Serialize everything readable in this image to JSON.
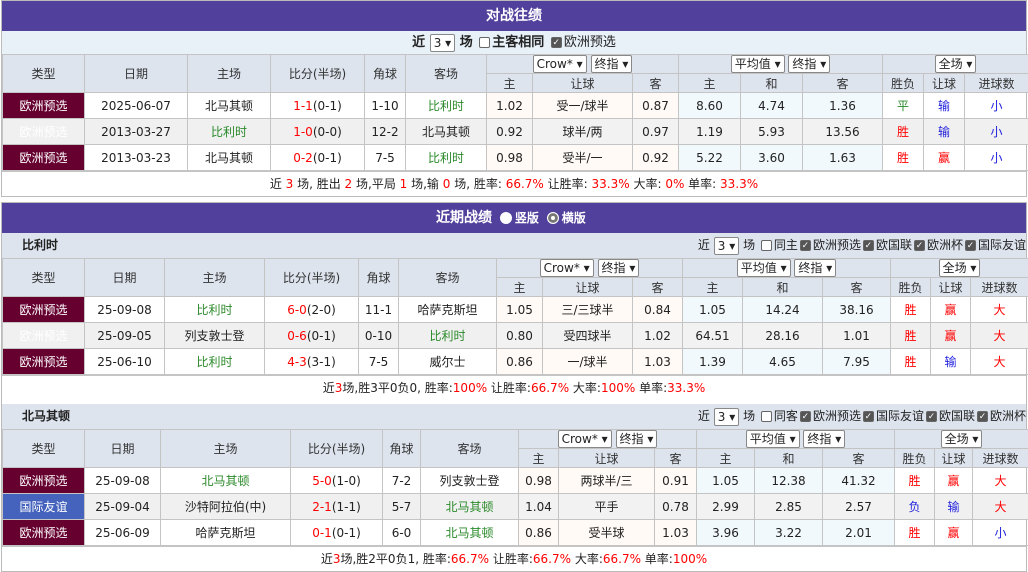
{
  "h2h": {
    "title": "对战往绩",
    "filter": {
      "near": "近",
      "count": "3",
      "unit": "场",
      "same_label": "主客相同",
      "same_checked": false,
      "euro_label": "欧洲预选",
      "euro_checked": true
    },
    "headers": {
      "type": "类型",
      "date": "日期",
      "home": "主场",
      "score": "比分(半场)",
      "corner": "角球",
      "away": "客场",
      "ah_sel1": "Crow*",
      "ah_sel2": "终指",
      "eu_sel1": "平均值",
      "eu_sel2": "终指",
      "res_sel": "全场",
      "ah_h": "主",
      "ah_line": "让球",
      "ah_a": "客",
      "eu_h": "主",
      "eu_d": "和",
      "eu_a": "客",
      "wl": "胜负",
      "hc": "让球",
      "ou": "进球数"
    },
    "rows": [
      {
        "type": "欧洲预选",
        "date": "2025-06-07",
        "home": "北马其顿",
        "home_hl": false,
        "score": "1-1",
        "half": "(0-1)",
        "corner": "1-10",
        "away": "比利时",
        "away_hl": true,
        "ah_h": "1.02",
        "ah_line": "受一/球半",
        "ah_a": "0.87",
        "eu_h": "8.60",
        "eu_d": "4.74",
        "eu_a": "1.36",
        "wl": "平",
        "hc": "输",
        "ou": "小"
      },
      {
        "type": "欧洲预选",
        "date": "2013-03-27",
        "home": "比利时",
        "home_hl": true,
        "score": "1-0",
        "half": "(0-0)",
        "corner": "12-2",
        "away": "北马其顿",
        "away_hl": false,
        "ah_h": "0.92",
        "ah_line": "球半/两",
        "ah_a": "0.97",
        "eu_h": "1.19",
        "eu_d": "5.93",
        "eu_a": "13.56",
        "wl": "胜",
        "hc": "输",
        "ou": "小"
      },
      {
        "type": "欧洲预选",
        "date": "2013-03-23",
        "home": "北马其顿",
        "home_hl": false,
        "score": "0-2",
        "half": "(0-1)",
        "corner": "7-5",
        "away": "比利时",
        "away_hl": true,
        "ah_h": "0.98",
        "ah_line": "受半/一",
        "ah_a": "0.92",
        "eu_h": "5.22",
        "eu_d": "3.60",
        "eu_a": "1.63",
        "wl": "胜",
        "hc": "赢",
        "ou": "小"
      }
    ],
    "summary": [
      [
        "近 ",
        0
      ],
      [
        "3",
        1
      ],
      [
        " 场, 胜出 ",
        0
      ],
      [
        "2",
        1
      ],
      [
        " 场,平局 ",
        0
      ],
      [
        "1",
        1
      ],
      [
        " 场,输 ",
        0
      ],
      [
        "0",
        1
      ],
      [
        " 场, 胜率: ",
        0
      ],
      [
        "66.7%",
        1
      ],
      [
        " 让胜率: ",
        0
      ],
      [
        "33.3%",
        1
      ],
      [
        " 大率: ",
        0
      ],
      [
        "0%",
        1
      ],
      [
        " 单率: ",
        0
      ],
      [
        "33.3%",
        1
      ]
    ]
  },
  "recent": {
    "title": "近期战绩",
    "opt1": "竖版",
    "opt2": "横版",
    "selected": "横版",
    "teams": [
      {
        "name": "比利时",
        "near": "近",
        "count": "3",
        "unit": "场",
        "same_label": "同主",
        "checks": [
          "欧洲预选",
          "欧国联",
          "欧洲杯",
          "国际友谊"
        ],
        "rows": [
          {
            "type": "欧洲预选",
            "date": "25-09-08",
            "home": "比利时",
            "home_hl": true,
            "score": "6-0",
            "half": "(2-0)",
            "corner": "11-1",
            "away": "哈萨克斯坦",
            "away_hl": false,
            "ah_h": "1.05",
            "ah_line": "三/三球半",
            "ah_a": "0.84",
            "eu_h": "1.05",
            "eu_d": "14.24",
            "eu_a": "38.16",
            "wl": "胜",
            "hc": "赢",
            "ou": "大"
          },
          {
            "type": "欧洲预选",
            "date": "25-09-05",
            "home": "列支敦士登",
            "home_hl": false,
            "score": "0-6",
            "half": "(0-1)",
            "corner": "0-10",
            "away": "比利时",
            "away_hl": true,
            "ah_h": "0.80",
            "ah_line": "受四球半",
            "ah_a": "1.02",
            "eu_h": "64.51",
            "eu_d": "28.16",
            "eu_a": "1.01",
            "wl": "胜",
            "hc": "赢",
            "ou": "大"
          },
          {
            "type": "欧洲预选",
            "date": "25-06-10",
            "home": "比利时",
            "home_hl": true,
            "score": "4-3",
            "half": "(3-1)",
            "corner": "7-5",
            "away": "威尔士",
            "away_hl": false,
            "ah_h": "0.86",
            "ah_line": "一/球半",
            "ah_a": "1.03",
            "eu_h": "1.39",
            "eu_d": "4.65",
            "eu_a": "7.95",
            "wl": "胜",
            "hc": "输",
            "ou": "大"
          }
        ],
        "summary": [
          [
            "近",
            0
          ],
          [
            "3",
            1
          ],
          [
            "场,胜3平0负0, 胜率:",
            0
          ],
          [
            "100%",
            1
          ],
          [
            " 让胜率:",
            0
          ],
          [
            "66.7%",
            1
          ],
          [
            " 大率:",
            0
          ],
          [
            "100%",
            1
          ],
          [
            " 单率:",
            0
          ],
          [
            "33.3%",
            1
          ]
        ]
      },
      {
        "name": "北马其顿",
        "near": "近",
        "count": "3",
        "unit": "场",
        "same_label": "同客",
        "checks": [
          "欧洲预选",
          "国际友谊",
          "欧国联",
          "欧洲杯"
        ],
        "rows": [
          {
            "type": "欧洲预选",
            "date": "25-09-08",
            "home": "北马其顿",
            "home_hl": true,
            "score": "5-0",
            "half": "(1-0)",
            "corner": "7-2",
            "away": "列支敦士登",
            "away_hl": false,
            "ah_h": "0.98",
            "ah_line": "两球半/三",
            "ah_a": "0.91",
            "eu_h": "1.05",
            "eu_d": "12.38",
            "eu_a": "41.32",
            "wl": "胜",
            "hc": "赢",
            "ou": "大"
          },
          {
            "type": "国际友谊",
            "type_color": "#4563bd",
            "date": "25-09-04",
            "home": "沙特阿拉伯(中)",
            "home_hl": false,
            "score": "2-1",
            "half": "(1-1)",
            "corner": "5-7",
            "away": "北马其顿",
            "away_hl": true,
            "ah_h": "1.04",
            "ah_line": "平手",
            "ah_a": "0.78",
            "eu_h": "2.99",
            "eu_d": "2.85",
            "eu_a": "2.57",
            "wl": "负",
            "hc": "输",
            "ou": "大"
          },
          {
            "type": "欧洲预选",
            "date": "25-06-09",
            "home": "哈萨克斯坦",
            "home_hl": false,
            "score": "0-1",
            "half": "(0-1)",
            "corner": "6-0",
            "away": "北马其顿",
            "away_hl": true,
            "ah_h": "0.86",
            "ah_line": "受半球",
            "ah_a": "1.03",
            "eu_h": "3.96",
            "eu_d": "3.22",
            "eu_a": "2.01",
            "wl": "胜",
            "hc": "赢",
            "ou": "小"
          }
        ],
        "summary": [
          [
            "近",
            0
          ],
          [
            "3",
            1
          ],
          [
            "场,胜2平0负1, 胜率:",
            0
          ],
          [
            "66.7%",
            1
          ],
          [
            " 让胜率:",
            0
          ],
          [
            "66.7%",
            1
          ],
          [
            " 大率:",
            0
          ],
          [
            "66.7%",
            1
          ],
          [
            " 单率:",
            0
          ],
          [
            "100%",
            1
          ]
        ]
      }
    ]
  },
  "colors": {
    "header": "#51409c",
    "type_bg": "#66002f",
    "friendly_bg": "#4563bd",
    "team_green": "#2a8a2a",
    "red": "#ff0000",
    "blue": "#2222dd"
  }
}
